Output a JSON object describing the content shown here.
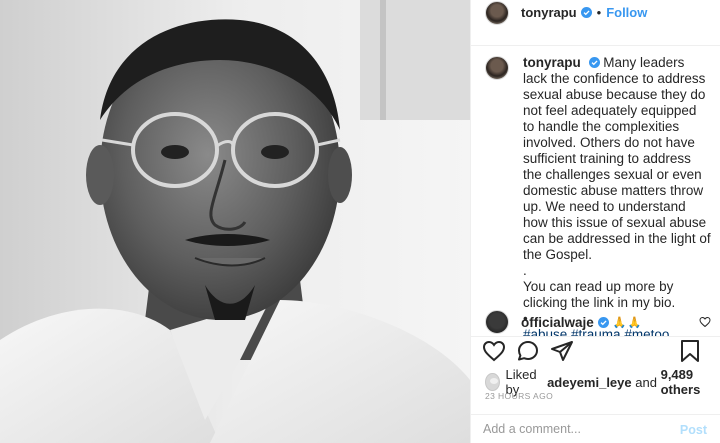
{
  "post": {
    "author": "tonyrapu",
    "follow_label": "Follow",
    "separator": "•",
    "caption_text": "Many leaders lack the confidence to address sexual abuse because they do not feel adequately equipped to handle the complexities involved. Others do not have sufficient training to address the challenges sexual or even domestic abuse matters throw up. We need to understand how this issue of sexual abuse can be addressed in the light of the Gospel.\n.\nYou can read up more by clicking the link in my bio.\n•",
    "hashtags": "#abuse #trauma #metoo",
    "caption_age": "23h",
    "comment": {
      "user": "officialwaje",
      "text": "🙏🙏"
    },
    "likes": {
      "prefix": "Liked by",
      "user": "adeyemi_leye",
      "connector": "and",
      "others": "9,489 others"
    },
    "timestamp": "23 HOURS AGO",
    "add_comment_placeholder": "Add a comment...",
    "post_label": "Post"
  },
  "icons": {
    "verified": "verified-badge-icon",
    "heart": "heart-icon",
    "comment": "comment-icon",
    "share": "share-icon",
    "save": "bookmark-icon",
    "emoji": "emoji-icon"
  },
  "colors": {
    "link_blue": "#3897f0",
    "hashtag_blue": "#003569",
    "muted_gray": "#999999",
    "post_disabled": "#b2dffc"
  }
}
